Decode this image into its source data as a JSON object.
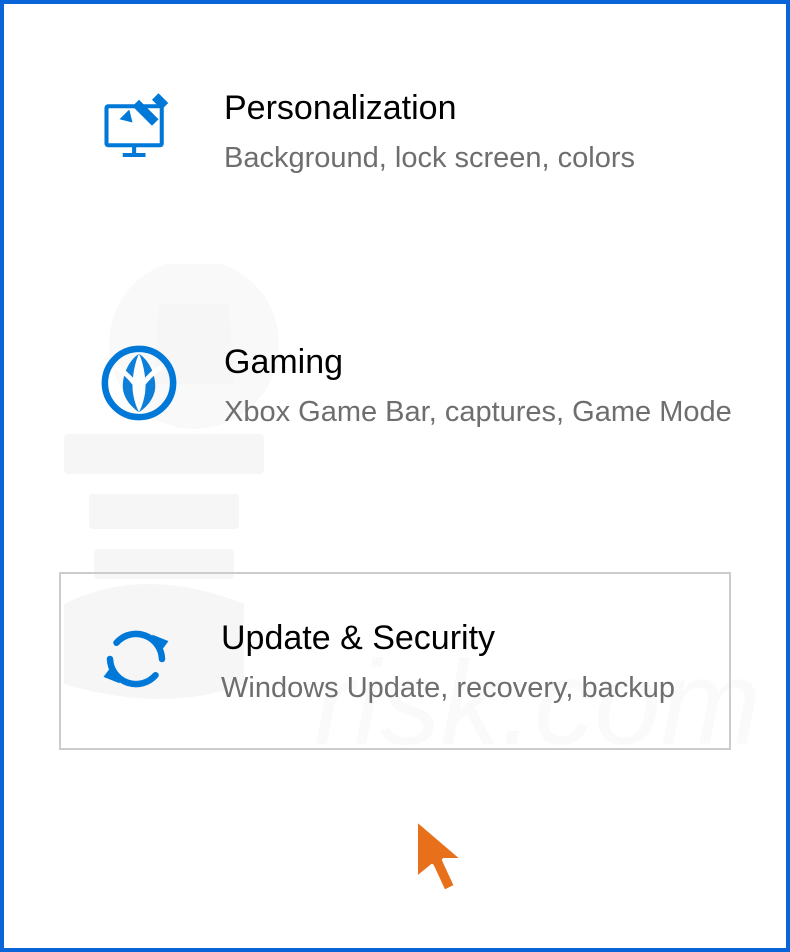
{
  "settings": {
    "items": [
      {
        "title": "Personalization",
        "desc": "Background, lock screen, colors"
      },
      {
        "title": "Gaming",
        "desc": "Xbox Game Bar, captures, Game Mode"
      },
      {
        "title": "Update & Security",
        "desc": "Windows Update, recovery, backup"
      }
    ]
  }
}
